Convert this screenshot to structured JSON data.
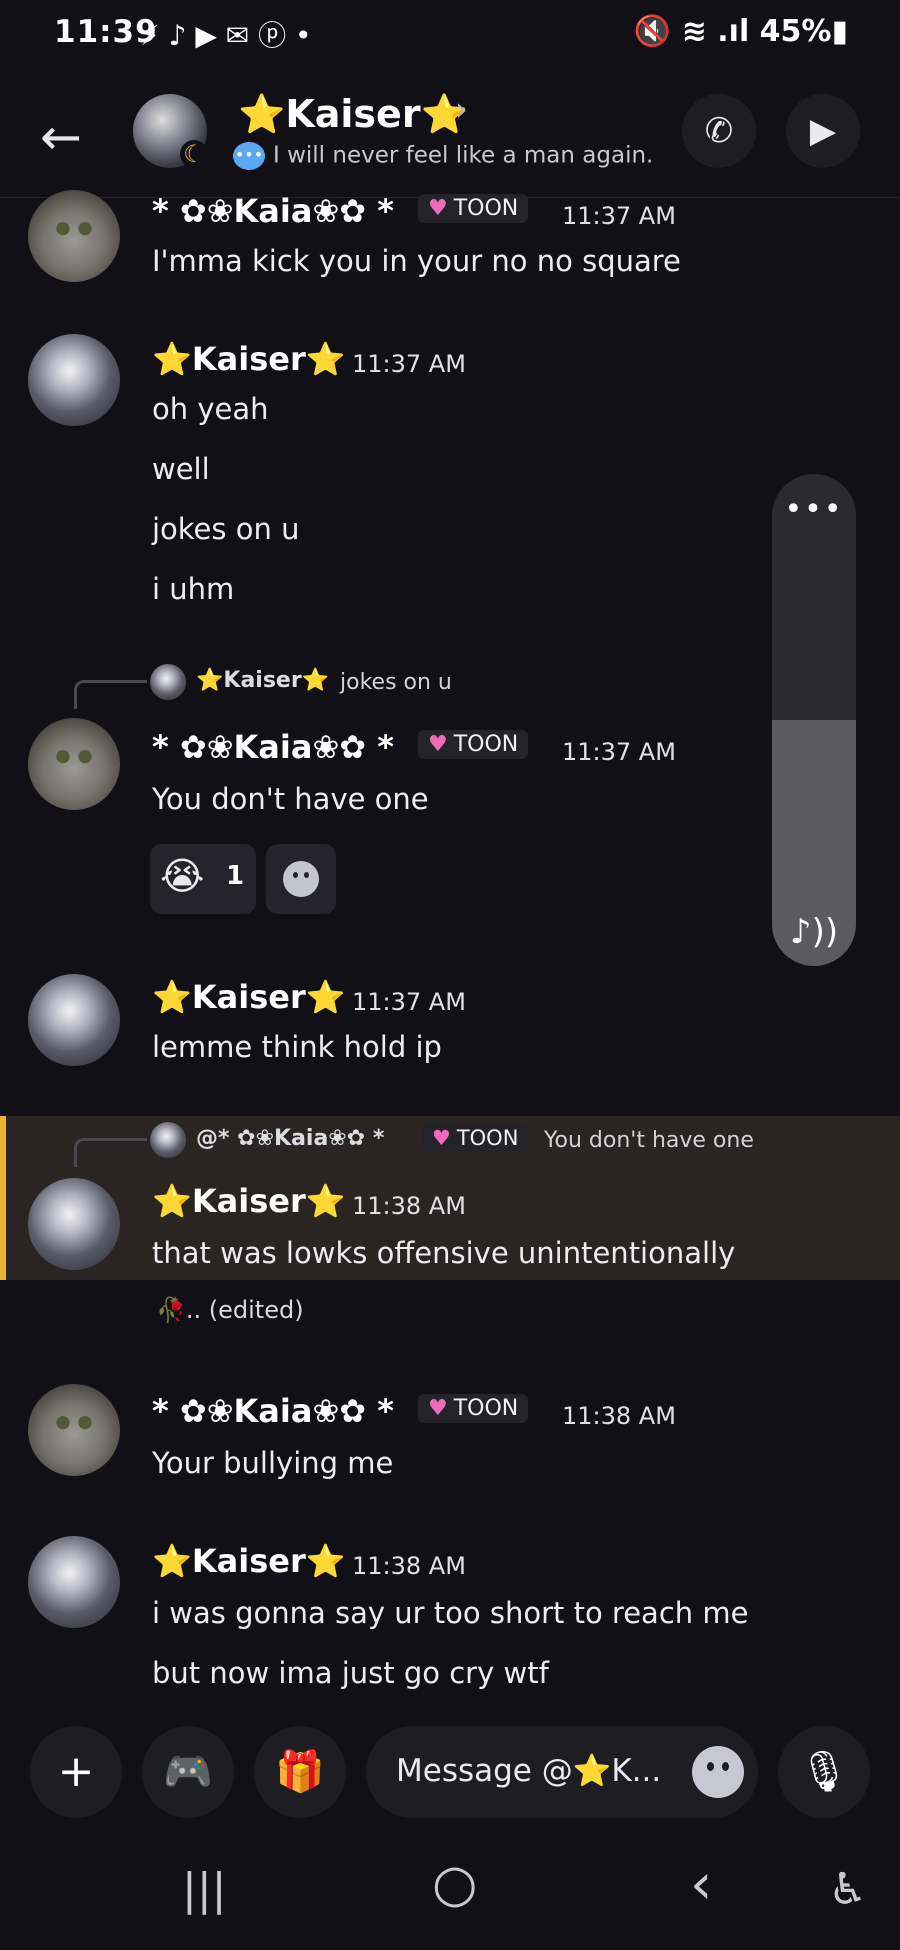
{
  "status_bar": {
    "time": "11:39",
    "app_icons": "⚡ ♪ ▶ ✉ ⓟ •",
    "system": "🔇 ≋ .ıl 45%▮"
  },
  "header": {
    "back_icon": "←",
    "title": "⭐Kaiser⭐",
    "chevron": "›",
    "status_icon": "💬",
    "status_text": "I will never feel like a man again.",
    "call_icon": "📞",
    "video_icon": "🎥"
  },
  "messages": [
    {
      "author": "* ✿❀Kaia❀✿ *",
      "tag": "TOON",
      "time": "11:37 AM",
      "lines": [
        "I'mma kick you in your no no square"
      ]
    },
    {
      "author": "⭐Kaiser⭐",
      "time": "11:37 AM",
      "lines": [
        "oh yeah",
        "well",
        "jokes on u",
        "i uhm"
      ]
    },
    {
      "reply_name": "⭐Kaiser⭐",
      "reply_text": "jokes on u",
      "author": "* ✿❀Kaia❀✿ *",
      "tag": "TOON",
      "time": "11:37 AM",
      "lines": [
        "You don't have one"
      ],
      "reaction": {
        "emoji": "😭",
        "count": "1"
      }
    },
    {
      "author": "⭐Kaiser⭐",
      "time": "11:37 AM",
      "lines": [
        "lemme think hold ip"
      ]
    },
    {
      "reply_name": "@* ✿❀Kaia❀✿ *",
      "reply_tag": "TOON",
      "reply_text": "You don't have one",
      "author": "⭐Kaiser⭐",
      "time": "11:38 AM",
      "lines": [
        "that was lowks offensive unintentionally"
      ],
      "followup": "🥀.. (edited)"
    },
    {
      "author": "* ✿❀Kaia❀✿ *",
      "tag": "TOON",
      "time": "11:38 AM",
      "lines": [
        "Your bullying me"
      ]
    },
    {
      "author": "⭐Kaiser⭐",
      "time": "11:38 AM",
      "lines": [
        "i was gonna say ur too short to reach me",
        "but now ima just go cry wtf"
      ]
    }
  ],
  "volume": {
    "dots": "•••",
    "level": 0.5,
    "note_icon": "♪))"
  },
  "composer": {
    "plus_icon": "+",
    "game_icon": "🎮",
    "gift_icon": "🎁",
    "placeholder": "Message @⭐K...",
    "mic_icon": "🎙"
  },
  "nav": {
    "recents": "|||",
    "home": "○",
    "back": "‹",
    "accessibility": "♿"
  }
}
